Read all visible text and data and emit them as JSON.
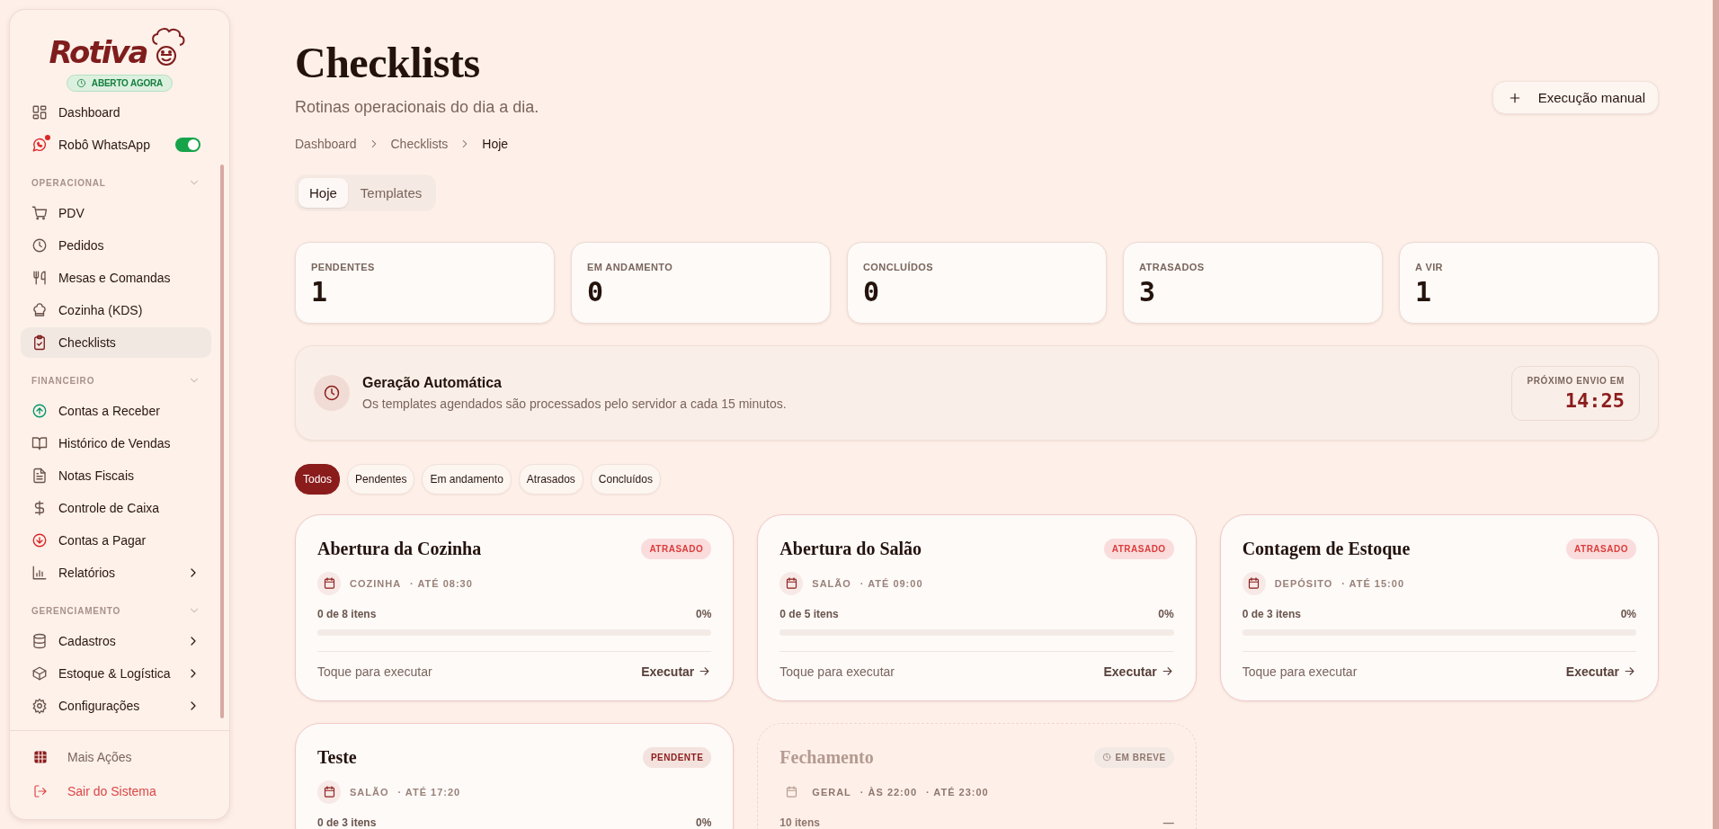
{
  "sidebar": {
    "logo": "Rotiva",
    "status_badge": "ABERTO AGORA",
    "top_items": [
      {
        "label": "Dashboard",
        "selected": false,
        "alert": false
      },
      {
        "label": "Robô WhatsApp",
        "selected": false,
        "alert": true,
        "on": true
      }
    ],
    "sections": [
      {
        "title": "OPERACIONAL",
        "expanded": true,
        "items": [
          {
            "label": "PDV",
            "selected": false,
            "has_submenu": false
          },
          {
            "label": "Pedidos",
            "selected": false,
            "has_submenu": false
          },
          {
            "label": "Mesas e Comandas",
            "selected": false,
            "has_submenu": false
          },
          {
            "label": "Cozinha (KDS)",
            "selected": false,
            "has_submenu": false
          },
          {
            "label": "Checklists",
            "selected": true,
            "has_submenu": false
          }
        ]
      },
      {
        "title": "FINANCEIRO",
        "expanded": true,
        "items": [
          {
            "label": "Contas a Receber",
            "selected": false,
            "has_submenu": false
          },
          {
            "label": "Histórico de Vendas",
            "selected": false,
            "has_submenu": false
          },
          {
            "label": "Notas Fiscais",
            "selected": false,
            "has_submenu": false
          },
          {
            "label": "Controle de Caixa",
            "selected": false,
            "has_submenu": false
          },
          {
            "label": "Contas a Pagar",
            "selected": false,
            "has_submenu": false
          },
          {
            "label": "Relatórios",
            "selected": false,
            "has_submenu": true
          }
        ]
      },
      {
        "title": "GERENCIAMENTO",
        "expanded": true,
        "items": [
          {
            "label": "Cadastros",
            "selected": false,
            "has_submenu": true
          },
          {
            "label": "Estoque & Logística",
            "selected": false,
            "has_submenu": true
          },
          {
            "label": "Configurações",
            "selected": false,
            "has_submenu": true
          }
        ]
      }
    ],
    "footer_items": [
      {
        "label": "Mais Ações",
        "kind": "normal"
      },
      {
        "label": "Sair do Sistema",
        "kind": "danger"
      }
    ]
  },
  "page": {
    "title": "Checklists",
    "subtitle": "Rotinas operacionais do dia a dia.",
    "primary_button": "Execução manual",
    "breadcrumb": [
      {
        "label": "Dashboard",
        "current": false
      },
      {
        "label": "Checklists",
        "current": false
      },
      {
        "label": "Hoje",
        "current": true
      }
    ]
  },
  "view_tabs": [
    {
      "label": "Hoje",
      "selected": true
    },
    {
      "label": "Templates",
      "selected": false
    }
  ],
  "stats": [
    {
      "label": "PENDENTES",
      "value": "1"
    },
    {
      "label": "EM ANDAMENTO",
      "value": "0"
    },
    {
      "label": "CONCLUÍDOS",
      "value": "0"
    },
    {
      "label": "ATRASADOS",
      "value": "3"
    },
    {
      "label": "A VIR",
      "value": "1"
    }
  ],
  "auto_panel": {
    "title": "Geração Automática",
    "description": "Os templates agendados são processados pelo servidor a cada 15 minutos.",
    "next_label": "PRÓXIMO ENVIO EM",
    "next_time": "14:25"
  },
  "filters": [
    {
      "label": "Todos",
      "selected": true
    },
    {
      "label": "Pendentes",
      "selected": false
    },
    {
      "label": "Em andamento",
      "selected": false
    },
    {
      "label": "Atrasados",
      "selected": false
    },
    {
      "label": "Concluídos",
      "selected": false
    }
  ],
  "checklists": [
    {
      "title": "Abertura da Cozinha",
      "status": "ATRASADO",
      "kind": "late",
      "disabled": false,
      "meta": [
        "COZINHA",
        "· ATÉ 08:30"
      ],
      "progress_text": "0 de 8 itens",
      "percent": "0%",
      "level": 0,
      "hint": "Toque para executar",
      "action": "Executar"
    },
    {
      "title": "Abertura do Salão",
      "status": "ATRASADO",
      "kind": "late",
      "disabled": false,
      "meta": [
        "SALÃO",
        "· ATÉ 09:00"
      ],
      "progress_text": "0 de 5 itens",
      "percent": "0%",
      "level": 0,
      "hint": "Toque para executar",
      "action": "Executar"
    },
    {
      "title": "Contagem de Estoque",
      "status": "ATRASADO",
      "kind": "late",
      "disabled": false,
      "meta": [
        "DEPÓSITO",
        "· ATÉ 15:00"
      ],
      "progress_text": "0 de 3 itens",
      "percent": "0%",
      "level": 0,
      "hint": "Toque para executar",
      "action": "Executar"
    },
    {
      "title": "Teste",
      "status": "PENDENTE",
      "kind": "pending",
      "disabled": false,
      "meta": [
        "SALÃO",
        "· ATÉ 17:20"
      ],
      "progress_text": "0 de 3 itens",
      "percent": "0%"
    },
    {
      "title": "Fechamento",
      "status": "EM BREVE",
      "kind": "soon",
      "disabled": true,
      "meta": [
        "GERAL",
        "· ÀS 22:00",
        "· ATÉ 23:00"
      ],
      "progress_text": "10 itens",
      "percent": "—"
    }
  ]
}
